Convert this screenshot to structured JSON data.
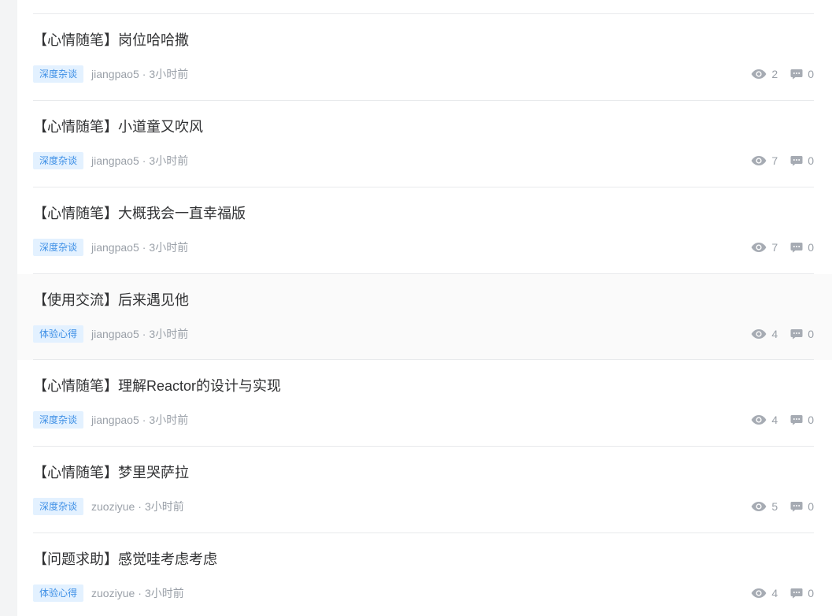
{
  "posts": [
    {
      "title": "【心情随笔】岗位哈哈撒",
      "tag": "深度杂谈",
      "author": "jiangpao5",
      "time": "3小时前",
      "views": "2",
      "comments": "0"
    },
    {
      "title": "【心情随笔】小道童又吹风",
      "tag": "深度杂谈",
      "author": "jiangpao5",
      "time": "3小时前",
      "views": "7",
      "comments": "0"
    },
    {
      "title": "【心情随笔】大概我会一直幸福版",
      "tag": "深度杂谈",
      "author": "jiangpao5",
      "time": "3小时前",
      "views": "7",
      "comments": "0"
    },
    {
      "title": "【使用交流】后来遇见他",
      "tag": "体验心得",
      "author": "jiangpao5",
      "time": "3小时前",
      "views": "4",
      "comments": "0"
    },
    {
      "title": "【心情随笔】理解Reactor的设计与实现",
      "tag": "深度杂谈",
      "author": "jiangpao5",
      "time": "3小时前",
      "views": "4",
      "comments": "0"
    },
    {
      "title": "【心情随笔】梦里哭萨拉",
      "tag": "深度杂谈",
      "author": "zuoziyue",
      "time": "3小时前",
      "views": "5",
      "comments": "0"
    },
    {
      "title": "【问题求助】感觉哇考虑考虑",
      "tag": "体验心得",
      "author": "zuoziyue",
      "time": "3小时前",
      "views": "4",
      "comments": "0"
    }
  ],
  "separator": "·",
  "icons": {
    "views": "eye-icon",
    "comments": "comment-icon"
  },
  "colors": {
    "tag_text": "#3d8fe6",
    "tag_bg": "#e3f1ff",
    "meta": "#9aa0a8",
    "title": "#303133"
  }
}
